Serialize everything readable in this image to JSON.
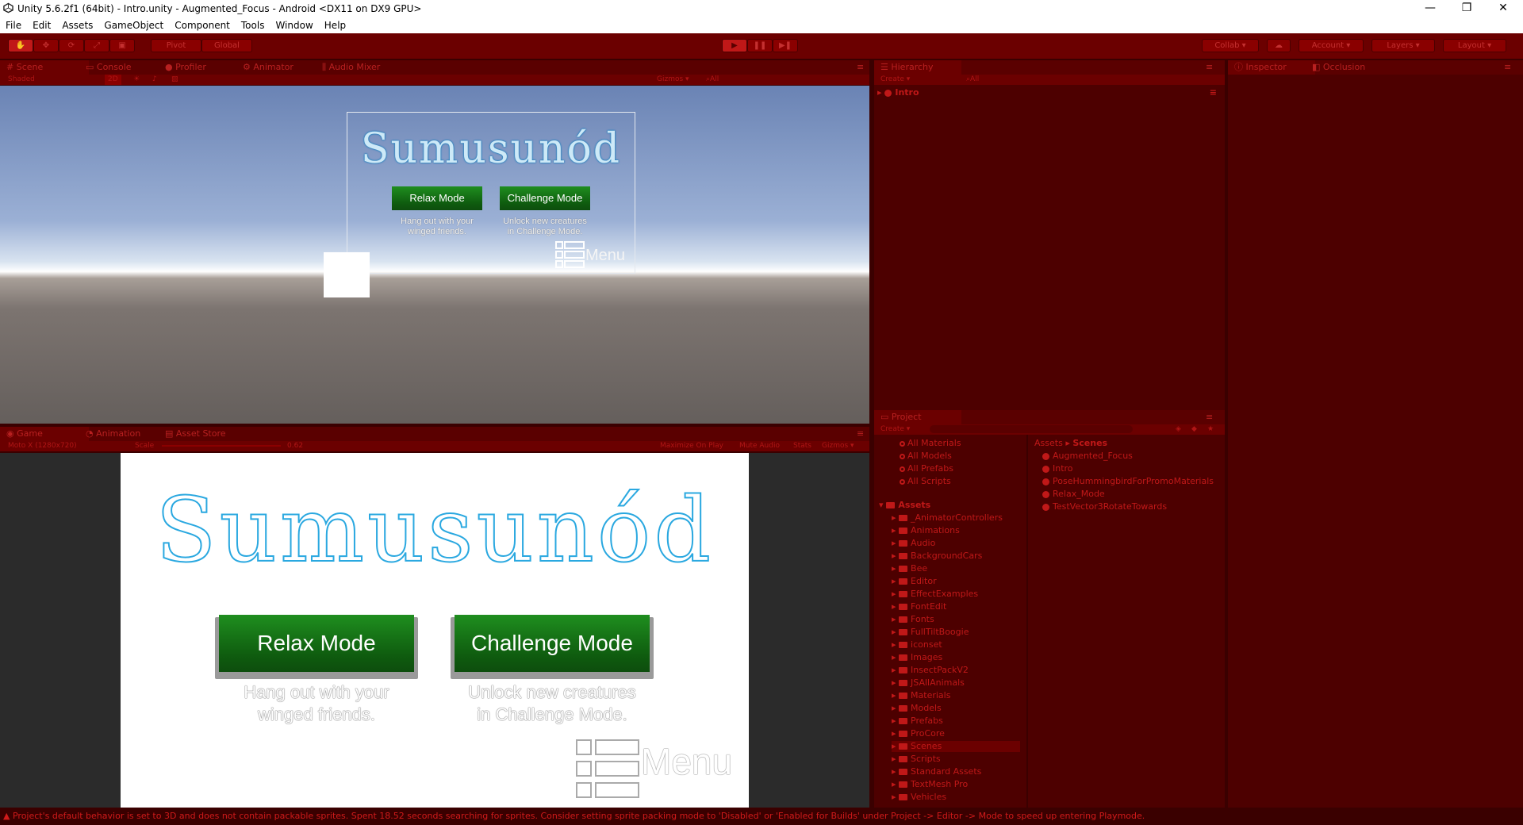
{
  "window": {
    "title": "Unity 5.6.2f1 (64bit) - Intro.unity - Augmented_Focus - Android <DX11 on DX9 GPU>",
    "minimize": "—",
    "maximize": "❐",
    "close": "✕"
  },
  "menubar": [
    "File",
    "Edit",
    "Assets",
    "GameObject",
    "Component",
    "Tools",
    "Window",
    "Help"
  ],
  "toolbar": {
    "pivot": "Pivot",
    "global": "Global",
    "collab": "Collab ▾",
    "account": "Account",
    "layers": "Layers",
    "layout": "Layout"
  },
  "scene_panel": {
    "tabs": [
      "Scene",
      "Console",
      "Profiler",
      "Animator",
      "Audio Mixer"
    ],
    "shading": "Shaded",
    "mode_2d": "2D",
    "gizmos": "Gizmos ▾",
    "search": "All"
  },
  "game_panel": {
    "tabs": [
      "Game",
      "Animation",
      "Asset Store"
    ],
    "resolution": "Moto X (1280x720)",
    "scale_label": "Scale",
    "scale_value": "0.62",
    "maximize_on_play": "Maximize On Play",
    "mute_audio": "Mute Audio",
    "stats": "Stats",
    "gizmos": "Gizmos ▾"
  },
  "app_ui": {
    "logo": "Sumusunód",
    "relax_button": "Relax Mode",
    "challenge_button": "Challenge Mode",
    "relax_caption_1": "Hang out with your",
    "relax_caption_2": "winged friends.",
    "challenge_caption_1": "Unlock new creatures",
    "challenge_caption_2": "in Challenge Mode.",
    "menu_label": "Menu"
  },
  "hierarchy": {
    "tab": "Hierarchy",
    "create": "Create ▾",
    "search": "All",
    "scene": "Intro"
  },
  "inspector": {
    "tabs": [
      "Inspector",
      "Occlusion"
    ]
  },
  "project": {
    "tab": "Project",
    "create": "Create ▾",
    "favorites": [
      "All Materials",
      "All Models",
      "All Prefabs",
      "All Scripts"
    ],
    "assets_root": "Assets",
    "folders": [
      "_AnimatorControllers",
      "Animations",
      "Audio",
      "BackgroundCars",
      "Bee",
      "Editor",
      "EffectExamples",
      "FontEdit",
      "Fonts",
      "FullTiltBoogie",
      "iconset",
      "Images",
      "InsectPackV2",
      "JSAllAnimals",
      "Materials",
      "Models",
      "Prefabs",
      "ProCore",
      "Scenes",
      "Scripts",
      "Standard Assets",
      "TextMesh Pro",
      "Vehicles"
    ],
    "selected_folder": "Scenes",
    "breadcrumb_root": "Assets",
    "breadcrumb_sep": "▸",
    "breadcrumb_current": "Scenes",
    "scene_files": [
      "Augmented_Focus",
      "Intro",
      "PoseHummingbirdForPromoMaterials",
      "Relax_Mode",
      "TestVector3RotateTowards"
    ]
  },
  "status": {
    "message": "Project's default behavior is set to 3D and does not contain packable sprites. Spent 18.52 seconds searching for sprites. Consider setting sprite packing mode to 'Disabled' or 'Enabled for Builds' under Project -> Editor -> Mode to speed up entering Playmode."
  },
  "colors": {
    "playmode_tint": "#4d0000",
    "toolbar": "#6b0000",
    "text_red": "#c01818",
    "button_green": "#127512",
    "logo_blue": "#2aa8e0"
  }
}
